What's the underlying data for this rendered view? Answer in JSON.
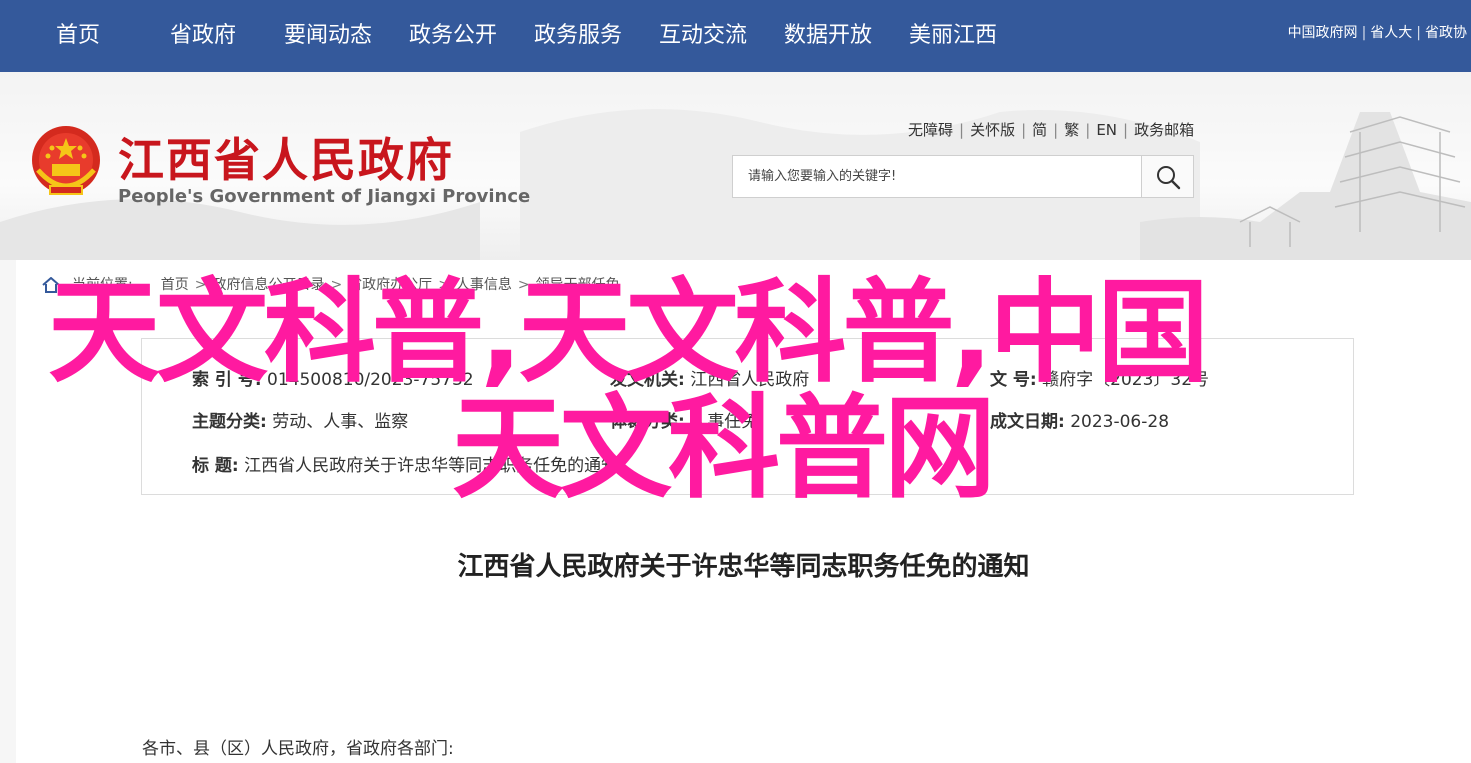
{
  "topnav": {
    "items": [
      "首页",
      "省政府",
      "要闻动态",
      "政务公开",
      "政务服务",
      "互动交流",
      "数据开放",
      "美丽江西"
    ],
    "links": [
      "中国政府网",
      "省人大",
      "省政协"
    ]
  },
  "header": {
    "title": "江西省人民政府",
    "subtitle": "People's Government of Jiangxi Province",
    "util_links": [
      "无障碍",
      "关怀版",
      "简",
      "繁",
      "EN",
      "政务邮箱"
    ],
    "search": {
      "placeholder": "请输入您要输入的关键字!"
    }
  },
  "breadcrumb": {
    "label": "当前位置:",
    "items": [
      "首页",
      "政府信息公开目录",
      "省政府办公厅",
      "人事信息",
      "领导干部任免"
    ]
  },
  "meta": {
    "index_label": "索  引  号:",
    "index_value": "014500810/2023-75732",
    "issuer_label": "发文机关:",
    "issuer_value": "江西省人民政府",
    "doc_no_label": "文  号:",
    "doc_no_value": "赣府字〔2023〕32号",
    "topic_label": "主题分类:",
    "topic_value": "劳动、人事、监察",
    "subject_label": "体裁分类:",
    "subject_value": "人事任免",
    "date_label": "成文日期:",
    "date_value": "2023-06-28",
    "title_label": "标        题:",
    "title_value": "江西省人民政府关于许忠华等同志职务任免的通知"
  },
  "document": {
    "title": "江西省人民政府关于许忠华等同志职务任免的通知",
    "greeting": "各市、县（区）人民政府，省政府各部门:"
  },
  "watermark": {
    "line1": "天文科普,天文科普,中国",
    "line2": "天文科普网",
    "color": "#ff1aa0"
  },
  "colors": {
    "nav_bg": "#34599b",
    "title_red": "#c8161d"
  }
}
